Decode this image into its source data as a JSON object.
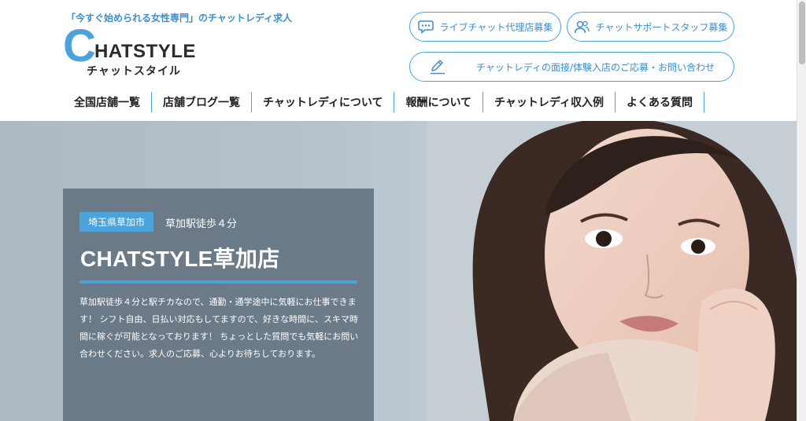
{
  "header": {
    "tagline": "「今すぐ始められる女性専門」のチャットレディ求人",
    "logo_c": "C",
    "logo_rest": "HATSTYLE",
    "logo_kana": "チャットスタイル"
  },
  "top_buttons": {
    "agency": "ライブチャット代理店募集",
    "support_staff": "チャットサポートスタッフ募集",
    "interview": "チャットレディの面接/体験入店のご応募・お問い合わせ"
  },
  "nav": {
    "items": [
      "全国店舗一覧",
      "店舗ブログ一覧",
      "チャットレディについて",
      "報酬について",
      "チャットレディ収入例",
      "よくある質問"
    ]
  },
  "hero": {
    "location_badge": "埼玉県草加市",
    "walk": "草加駅徒歩４分",
    "title": "CHATSTYLE草加店",
    "description": "草加駅徒歩４分と駅チカなので、通勤・通学途中に気軽にお仕事できます！ シフト自由、日払い対応もしてますので、好きな時間に、スキマ時間に稼ぐが可能となっております！ ちょっとした質問でも気軽にお問い合わせください。求人のご応募、心よりお待ちしております。"
  },
  "colors": {
    "accent": "#4aa3dc",
    "card_bg": "#5f6e7d",
    "text_dark": "#222222"
  },
  "icons": {
    "agency": "chat-bubble-icon",
    "support_staff": "people-icon",
    "interview": "pencil-icon"
  }
}
